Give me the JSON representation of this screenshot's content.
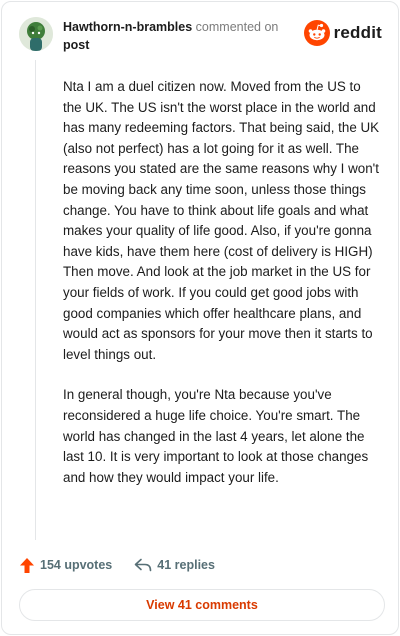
{
  "header": {
    "username": "Hawthorn-n-brambles",
    "commented_on": "commented on",
    "post_link": "post",
    "brand": "reddit"
  },
  "comment": {
    "paragraphs": [
      "Nta I am a duel citizen now. Moved from the US to the UK. The US isn't the worst place in the world and has many redeeming factors. That being said, the UK (also not perfect) has a lot going for it as well. The reasons you stated are the same reasons why I won't be moving back any time soon, unless those things change. You have to think about life goals and what makes your quality of life good. Also, if you're gonna have kids, have them here (cost of delivery is HIGH) Then move. And look at the job market in the US for your fields of work. If you could get good jobs with good companies which offer healthcare plans, and would act as sponsors for your move then it starts to level things out.",
      "In general though, you're Nta because you've reconsidered a huge life choice. You're smart. The world has changed in the last 4 years, let alone the last 10. It is very important to look at those changes and how they would impact your life."
    ]
  },
  "actions": {
    "upvotes": "154 upvotes",
    "replies": "41 replies"
  },
  "footer": {
    "view_comments": "View 41 comments"
  },
  "colors": {
    "accent": "#ff4500",
    "link_orange": "#d93a00",
    "muted": "#576f76"
  },
  "icons": [
    "avatar",
    "reddit-logo-icon",
    "upvote-icon",
    "reply-icon"
  ]
}
